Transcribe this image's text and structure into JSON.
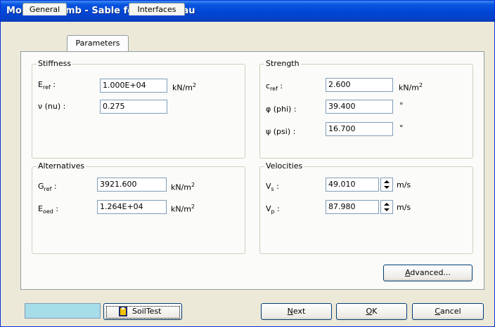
{
  "window": {
    "title": "Mohr-Coulomb - Sable fontainebleau"
  },
  "tabs": [
    {
      "label": "General"
    },
    {
      "label": "Parameters"
    },
    {
      "label": "Interfaces"
    }
  ],
  "stiffness": {
    "legend": "Stiffness",
    "eref": {
      "label": "E",
      "sub": "ref",
      "colon": " :",
      "value": "1.000E+04",
      "unit": "kN/m",
      "unit_sup": "2"
    },
    "nu": {
      "label": "ν (nu) :",
      "value": "0.275"
    }
  },
  "strength": {
    "legend": "Strength",
    "cref": {
      "label": "c",
      "sub": "ref",
      "colon": " :",
      "value": "2.600",
      "unit": "kN/m",
      "unit_sup": "2"
    },
    "phi": {
      "label": "φ (phi) :",
      "value": "39.400",
      "unit": "°"
    },
    "psi": {
      "label": "ψ (psi) :",
      "value": "16.700",
      "unit": "°"
    }
  },
  "alternatives": {
    "legend": "Alternatives",
    "gref": {
      "label": "G",
      "sub": "ref",
      "colon": " :",
      "value": "3921.600",
      "unit": "kN/m",
      "unit_sup": "2"
    },
    "eoed": {
      "label": "E",
      "sub": "oed",
      "colon": " :",
      "value": "1.264E+04",
      "unit": "kN/m",
      "unit_sup": "2"
    }
  },
  "velocities": {
    "legend": "Velocities",
    "vs": {
      "label": "V",
      "sub": "s",
      "colon": " :",
      "value": "49.010",
      "unit": "m/s"
    },
    "vp": {
      "label": "V",
      "sub": "p",
      "colon": " :",
      "value": "87.980",
      "unit": "m/s"
    }
  },
  "buttons": {
    "advanced": {
      "mnemonic": "A",
      "rest": "dvanced..."
    },
    "soiltest": {
      "label": "SoilTest"
    },
    "next": {
      "mnemonic": "N",
      "rest": "ext"
    },
    "ok": {
      "mnemonic": "O",
      "rest": "K"
    },
    "cancel": {
      "mnemonic": "C",
      "rest": "ancel"
    }
  },
  "colors": {
    "title_bar": "#0046d5",
    "material_color_swatch": "#a6dde8",
    "dialog_bg": "#ece9d8"
  }
}
